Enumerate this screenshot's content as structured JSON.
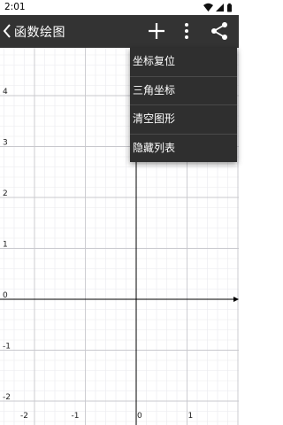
{
  "status_bar": {
    "time": "2:01"
  },
  "app_bar": {
    "title": "函数绘图"
  },
  "menu": {
    "items": [
      {
        "label": "坐标复位"
      },
      {
        "label": "三角坐标"
      },
      {
        "label": "清空图形"
      },
      {
        "label": "隐藏列表"
      }
    ]
  },
  "graph": {
    "x_ticks": [
      "-2",
      "-1",
      "0",
      "1"
    ],
    "y_ticks": [
      "4",
      "3",
      "2",
      "1",
      "0",
      "-1",
      "-2"
    ]
  },
  "colors": {
    "app_bar": "#333333",
    "menu": "#2f2f2f",
    "grid_major": "#c8c8cd",
    "grid_minor": "#e9e9ee",
    "axis": "#000000"
  }
}
